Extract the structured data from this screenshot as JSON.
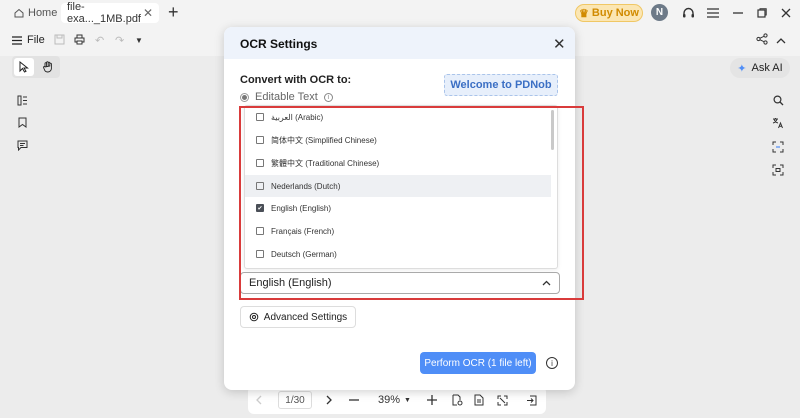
{
  "tabs": {
    "home_label": "Home",
    "file_label": "file-exa..._1MB.pdf",
    "close_glyph": "✕",
    "add_glyph": "+"
  },
  "header": {
    "buy_now_label": "Buy Now",
    "avatar_initial": "N"
  },
  "toolbar": {
    "file_label": "File"
  },
  "right_panel": {
    "ask_ai_label": "Ask AI"
  },
  "bottom_nav": {
    "page": "1/30",
    "zoom": "39%"
  },
  "modal": {
    "title": "OCR Settings",
    "convert_label": "Convert with OCR to:",
    "option_label": "Editable Text",
    "preview_text": "Welcome to PDNob",
    "languages": [
      {
        "label": "العربية (Arabic)",
        "checked": false
      },
      {
        "label": "简体中文 (Simplified Chinese)",
        "checked": false
      },
      {
        "label": "繁體中文 (Traditional Chinese)",
        "checked": false
      },
      {
        "label": "Nederlands (Dutch)",
        "checked": false
      },
      {
        "label": "English (English)",
        "checked": true
      },
      {
        "label": "Français (French)",
        "checked": false
      },
      {
        "label": "Deutsch (German)",
        "checked": false
      }
    ],
    "selected_language": "English (English)",
    "advanced_label": "Advanced Settings",
    "perform_label": "Perform OCR (1 file left)"
  },
  "colors": {
    "accent": "#4f8ef7",
    "highlight": "#d93b3b",
    "buy_now": "#d18b00"
  }
}
